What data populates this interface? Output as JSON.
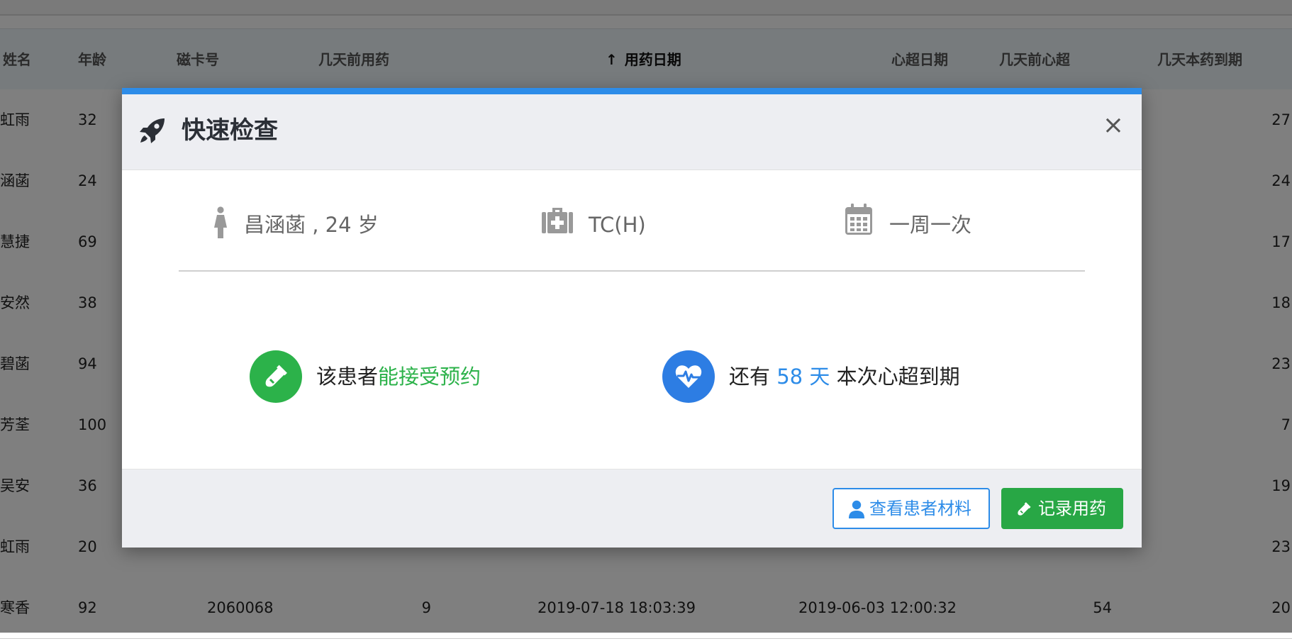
{
  "table": {
    "headers": {
      "name": "姓名",
      "age": "年龄",
      "card": "磁卡号",
      "days_since_med": "几天前用药",
      "med_date": "用药日期",
      "echo_date": "心超日期",
      "days_since_echo": "几天前心超",
      "days_to_expire": "几天本药到期"
    },
    "rows": [
      {
        "name": "虹雨",
        "age": "32",
        "card": "",
        "days_since_med": "",
        "med_date": "",
        "echo_date": "",
        "days_since_echo": "",
        "days_to_expire": "27"
      },
      {
        "name": "涵菡",
        "age": "24",
        "card": "",
        "days_since_med": "",
        "med_date": "",
        "echo_date": "",
        "days_since_echo": "",
        "days_to_expire": "24"
      },
      {
        "name": "慧捷",
        "age": "69",
        "card": "",
        "days_since_med": "",
        "med_date": "",
        "echo_date": "",
        "days_since_echo": "",
        "days_to_expire": "17"
      },
      {
        "name": "安然",
        "age": "38",
        "card": "",
        "days_since_med": "",
        "med_date": "",
        "echo_date": "",
        "days_since_echo": "",
        "days_to_expire": "18"
      },
      {
        "name": "碧菡",
        "age": "94",
        "card": "",
        "days_since_med": "",
        "med_date": "",
        "echo_date": "",
        "days_since_echo": "",
        "days_to_expire": "23"
      },
      {
        "name": "芳荃",
        "age": "100",
        "card": "",
        "days_since_med": "",
        "med_date": "",
        "echo_date": "",
        "days_since_echo": "",
        "days_to_expire": "7"
      },
      {
        "name": "吴安",
        "age": "36",
        "card": "",
        "days_since_med": "",
        "med_date": "",
        "echo_date": "",
        "days_since_echo": "",
        "days_to_expire": "19"
      },
      {
        "name": "虹雨",
        "age": "20",
        "card": "",
        "days_since_med": "",
        "med_date": "",
        "echo_date": "",
        "days_since_echo": "",
        "days_to_expire": "23"
      },
      {
        "name": "寒香",
        "age": "92",
        "card": "2060068",
        "days_since_med": "9",
        "med_date": "2019-07-18 18:03:39",
        "echo_date": "2019-06-03 12:00:32",
        "days_since_echo": "54",
        "days_to_expire": "20"
      }
    ]
  },
  "modal": {
    "title": "快速检查",
    "close": "×",
    "patient": {
      "name_age": "昌涵菡 , 24 岁",
      "regimen": "TC(H)",
      "frequency": "一周一次"
    },
    "status_booking": {
      "prefix": "该患者",
      "highlight": "能接受预约"
    },
    "status_echo": {
      "prefix": "还有",
      "highlight": "58 天",
      "suffix": "本次心超到期"
    },
    "buttons": {
      "view": "查看患者材料",
      "record": "记录用药"
    }
  },
  "colors": {
    "accent": "#2d8ce8",
    "success": "#28a745",
    "overlay": "rgba(0,0,0,0.5)"
  }
}
